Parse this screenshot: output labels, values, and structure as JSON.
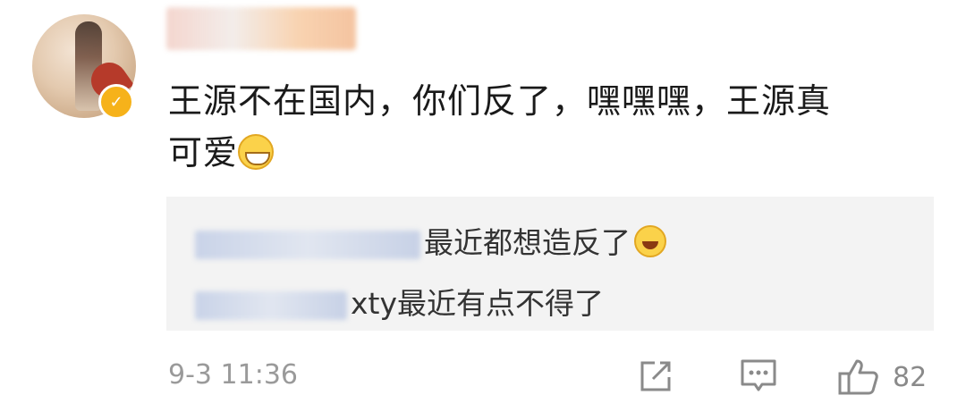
{
  "comment": {
    "text_line1": "王源不在国内，你们反了，嘿嘿嘿，王源真",
    "text_line2": "可爱",
    "emoji_icon": "grin-icon"
  },
  "replies": [
    {
      "prefix": "運",
      "text": "最近都想造反了",
      "emoji_icon": "laugh-icon"
    },
    {
      "prefix": "",
      "text": "xty最近有点不得了"
    }
  ],
  "meta": {
    "timestamp": "9-3 11:36",
    "like_count": "82"
  },
  "colors": {
    "badge": "#f6b21a",
    "reply_bg": "#f3f3f3",
    "meta_gray": "#9a9a9a"
  }
}
